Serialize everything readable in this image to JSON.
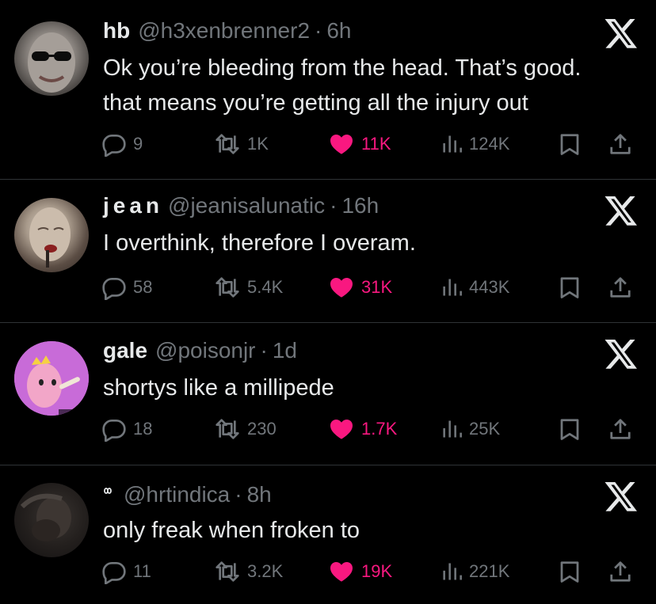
{
  "colors": {
    "background": "#000000",
    "text_primary": "#e7e9ea",
    "text_secondary": "#71767b",
    "like_active": "#f91880",
    "divider": "#2f3336"
  },
  "icons": {
    "reply": "speech-bubble-icon",
    "retweet": "retweet-arrows-icon",
    "like": "heart-filled-icon",
    "views": "bar-chart-icon",
    "bookmark": "bookmark-icon",
    "share": "share-upload-icon",
    "source": "x-logo-icon"
  },
  "tweets": [
    {
      "name": "hb",
      "handle": "@h3xenbrenner2",
      "dot": "·",
      "time": "6h",
      "text_lines": [
        "Ok you’re bleeding from the head. That’s good.",
        "that means you’re getting all the injury out"
      ],
      "replies": "9",
      "retweets": "1K",
      "likes": "11K",
      "views": "124K"
    },
    {
      "name": "jean",
      "handle": "@jeanisalunatic",
      "dot": "·",
      "time": "16h",
      "text_lines": [
        "I overthink, therefore I overam."
      ],
      "replies": "58",
      "retweets": "5.4K",
      "likes": "31K",
      "views": "443K"
    },
    {
      "name": "gale",
      "handle": "@poisonjr",
      "dot": "·",
      "time": "1d",
      "text_lines": [
        "shortys like a millipede"
      ],
      "replies": "18",
      "retweets": "230",
      "likes": "1.7K",
      "views": "25K"
    },
    {
      "name": "",
      "handle": "@hrtindica",
      "dot": "·",
      "time": "8h",
      "text_lines": [
        "only freak when froken to"
      ],
      "replies": "11",
      "retweets": "3.2K",
      "likes": "19K",
      "views": "221K"
    }
  ]
}
